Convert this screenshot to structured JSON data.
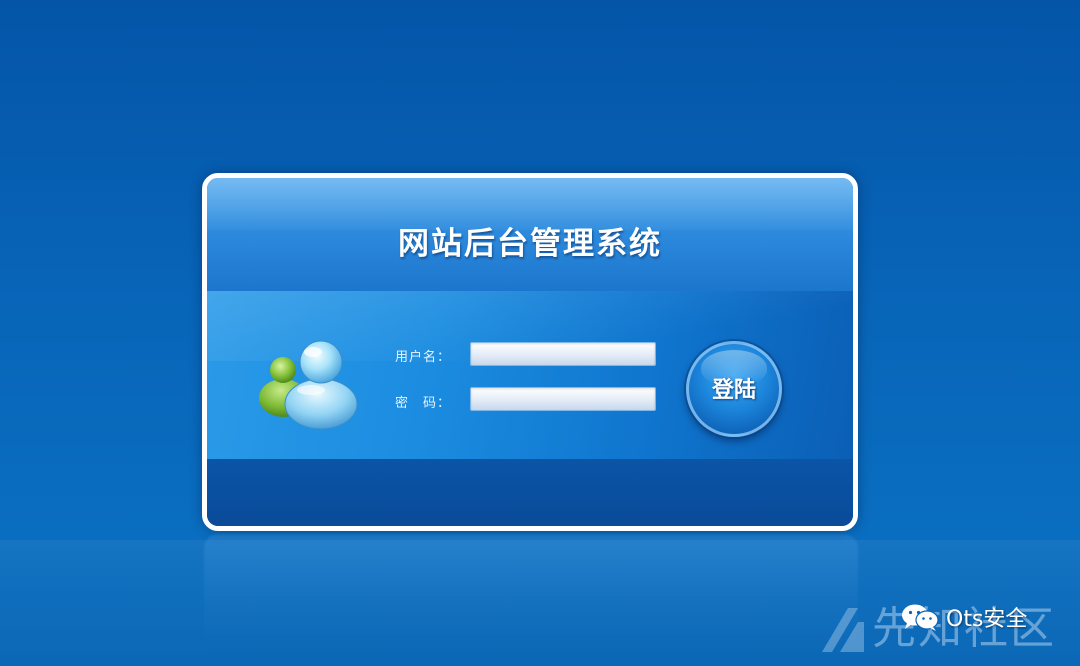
{
  "login_panel": {
    "title": "网站后台管理系统",
    "username_label": "用户名：",
    "username_value": "",
    "password_label": "密　码：",
    "password_value": "",
    "login_button_label": "登陆",
    "users_icon": "users-icon"
  },
  "watermarks": {
    "wechat_icon": "wechat-icon",
    "wechat_text": "Ots安全",
    "community_text": "先知社区",
    "community_logo": "xz-logo-icon"
  },
  "colors": {
    "background": "#0865b8",
    "panel_border": "#ffffff",
    "header": "#2f8ddf",
    "body": "#1b8ce0",
    "footer": "#0a4e9f",
    "green_user": "#7cc03a",
    "blue_user": "#8fd6f5"
  }
}
